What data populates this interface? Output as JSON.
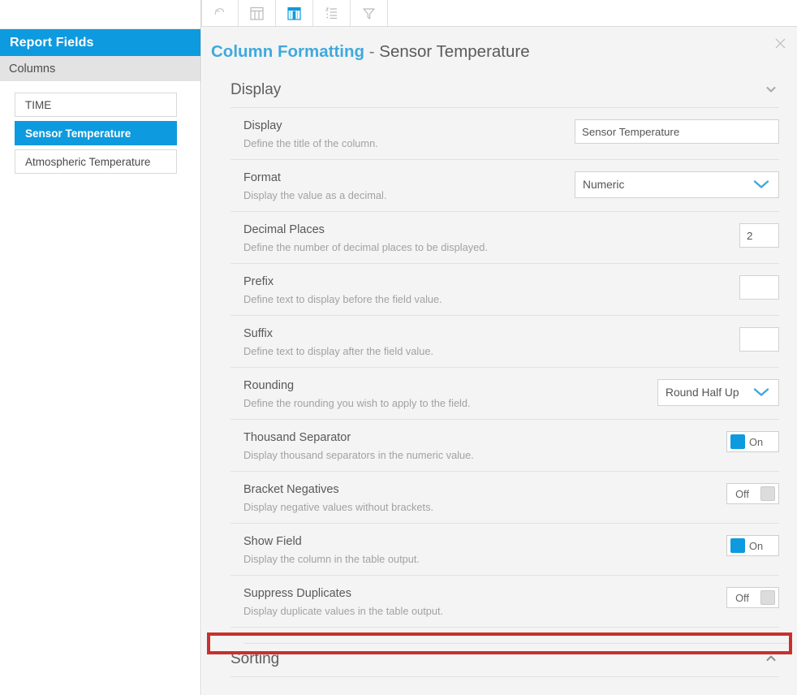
{
  "toolbar": {
    "buttons": [
      {
        "name": "undo-icon",
        "label": "Undo",
        "active": false
      },
      {
        "name": "table-icon",
        "label": "Table",
        "active": false
      },
      {
        "name": "columns-icon",
        "label": "Columns",
        "active": true
      },
      {
        "name": "list-icon",
        "label": "List",
        "active": false
      },
      {
        "name": "filter-icon",
        "label": "Filter",
        "active": false
      }
    ]
  },
  "sidebar": {
    "title": "Report Fields",
    "subtitle": "Columns",
    "fields": [
      {
        "label": "TIME",
        "selected": false
      },
      {
        "label": "Sensor Temperature",
        "selected": true
      },
      {
        "label": "Atmospheric Temperature",
        "selected": false
      }
    ]
  },
  "panel": {
    "title_accent": "Column Formatting",
    "title_separator": " - ",
    "title_subject": "Sensor Temperature",
    "close_label": "×"
  },
  "display_section": {
    "title": "Display",
    "chevron": "⌄",
    "expanded": true,
    "rows": [
      {
        "label": "Display",
        "description": "Define the title of the column.",
        "control": "text",
        "value": "Sensor Temperature",
        "placeholder": ""
      },
      {
        "label": "Format",
        "description": "Display the value as a decimal.",
        "control": "select",
        "value": "Numeric"
      },
      {
        "label": "Decimal Places",
        "description": "Define the number of decimal places to be displayed.",
        "control": "text-small",
        "value": "2",
        "placeholder": ""
      },
      {
        "label": "Prefix",
        "description": "Define text to display before the field value.",
        "control": "text-small",
        "value": "",
        "placeholder": ""
      },
      {
        "label": "Suffix",
        "description": "Define text to display after the field value.",
        "control": "text-small",
        "value": "",
        "placeholder": ""
      },
      {
        "label": "Rounding",
        "description": "Define the rounding you wish to apply to the field.",
        "control": "select-med",
        "value": "Round Half Up"
      },
      {
        "label": "Thousand Separator",
        "description": "Display thousand separators in the numeric value.",
        "control": "toggle",
        "value": "On",
        "state": "on"
      },
      {
        "label": "Bracket Negatives",
        "description": "Display negative values without brackets.",
        "control": "toggle",
        "value": "Off",
        "state": "off"
      },
      {
        "label": "Show Field",
        "description": "Display the column in the table output.",
        "control": "toggle",
        "value": "On",
        "state": "on"
      },
      {
        "label": "Suppress Duplicates",
        "description": "Display duplicate values in the table output.",
        "control": "toggle",
        "value": "Off",
        "state": "off"
      }
    ]
  },
  "sorting_section": {
    "title": "Sorting",
    "chevron": "⌃",
    "expanded": false
  },
  "colors": {
    "accent_blue": "#0e9ade",
    "title_blue": "#3fa9dd",
    "panel_bg": "#f4f4f4",
    "highlight_red": "#c9302c",
    "toggle_on": "#0e9ade",
    "toggle_off": "#dcdcdc"
  }
}
